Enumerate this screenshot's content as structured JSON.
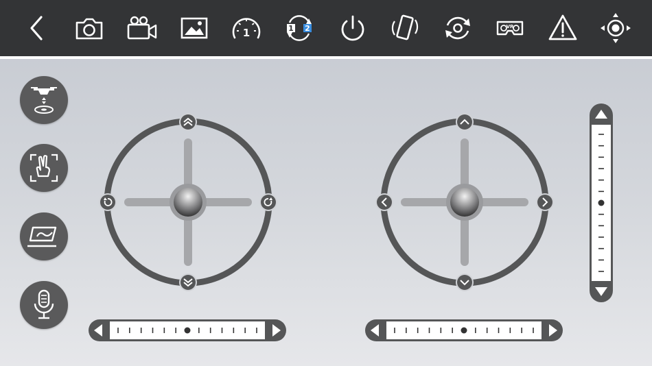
{
  "colors": {
    "toolbar_bg": "#333436",
    "icon": "#ffffff",
    "accent_blue": "#3a8ee0",
    "control_dark": "#555657",
    "stick_arm": "#a6a7aa"
  },
  "toolbar": {
    "items": [
      {
        "name": "back",
        "icon": "chevron-left-icon"
      },
      {
        "name": "take-photo",
        "icon": "camera-icon"
      },
      {
        "name": "record-video",
        "icon": "video-camera-icon"
      },
      {
        "name": "gallery",
        "icon": "image-icon"
      },
      {
        "name": "speed-mode",
        "icon": "speedometer-icon",
        "text": "1"
      },
      {
        "name": "camera-switch",
        "icon": "camera-switch-icon",
        "text_a": "1",
        "text_b": "2"
      },
      {
        "name": "power",
        "icon": "power-icon"
      },
      {
        "name": "gravity-control",
        "icon": "phone-tilt-icon"
      },
      {
        "name": "flip",
        "icon": "rotate-360-icon"
      },
      {
        "name": "vr-mode",
        "icon": "vr-goggles-icon",
        "text": "VR"
      },
      {
        "name": "emergency-stop",
        "icon": "warning-icon"
      },
      {
        "name": "headless-mode",
        "icon": "direction-pad-icon"
      }
    ]
  },
  "left_panel": {
    "buttons": [
      {
        "name": "takeoff-land",
        "icon": "drone-landing-icon"
      },
      {
        "name": "gesture-control",
        "icon": "hand-gesture-icon"
      },
      {
        "name": "trajectory-flight",
        "icon": "trajectory-icon"
      },
      {
        "name": "voice-control",
        "icon": "microphone-icon"
      }
    ]
  },
  "sticks": {
    "left": {
      "role": "throttle-yaw",
      "top_icon": "double-chevron-up-icon",
      "bottom_icon": "double-chevron-down-icon",
      "left_icon": "rotate-left-icon",
      "right_icon": "rotate-right-icon"
    },
    "right": {
      "role": "pitch-roll",
      "top_icon": "chevron-up-icon",
      "bottom_icon": "chevron-down-icon",
      "left_icon": "chevron-left-icon",
      "right_icon": "chevron-right-icon"
    }
  },
  "trims": {
    "left_horizontal": {
      "value": 0.5
    },
    "right_horizontal": {
      "value": 0.5
    },
    "right_vertical": {
      "value": 0.5
    }
  }
}
